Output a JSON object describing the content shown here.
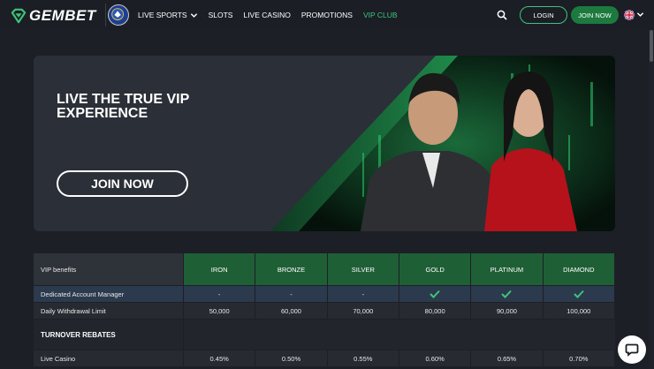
{
  "header": {
    "brand": "GEMBET",
    "nav": [
      {
        "label": "LIVE SPORTS",
        "has_dropdown": true
      },
      {
        "label": "SLOTS"
      },
      {
        "label": "LIVE CASINO"
      },
      {
        "label": "PROMOTIONS"
      },
      {
        "label": "VIP CLUB",
        "active": true
      }
    ],
    "login_label": "LOGIN",
    "join_label": "JOIN NOW",
    "accent_color": "#3ec47a"
  },
  "banner": {
    "title": "LIVE THE TRUE VIP EXPERIENCE",
    "cta_label": "JOIN NOW"
  },
  "vip_table": {
    "benefits_header": "VIP benefits",
    "tiers": [
      "IRON",
      "BRONZE",
      "SILVER",
      "GOLD",
      "PLATINUM",
      "DIAMOND"
    ],
    "rows": [
      {
        "label": "Dedicated Account Manager",
        "values": [
          "-",
          "-",
          "-",
          "check",
          "check",
          "check"
        ]
      },
      {
        "label": "Daily Withdrawal Limit",
        "values": [
          "50,000",
          "60,000",
          "70,000",
          "80,000",
          "90,000",
          "100,000"
        ]
      }
    ],
    "section_title": "TURNOVER REBATES",
    "rebate_rows": [
      {
        "label": "Live Casino",
        "values": [
          "0.45%",
          "0.50%",
          "0.55%",
          "0.60%",
          "0.65%",
          "0.70%"
        ]
      }
    ]
  }
}
